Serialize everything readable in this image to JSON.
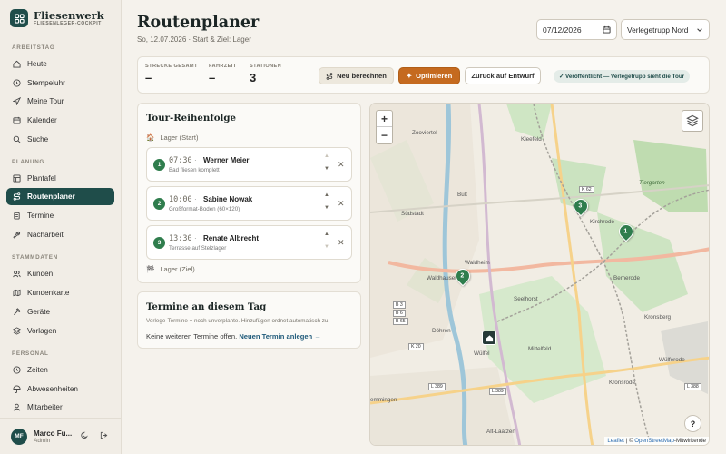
{
  "brand": {
    "name": "Fliesenwerk",
    "subtitle": "FLIESENLEGER-COCKPIT"
  },
  "nav": {
    "sections": {
      "arbeitstag": "ARBEITSTAG",
      "planung": "PLANUNG",
      "stammdaten": "STAMMDATEN",
      "persoenlich": "PERSONAL"
    },
    "items": {
      "heute": "Heute",
      "stempeluhr": "Stempeluhr",
      "meine_tour": "Meine Tour",
      "kalender": "Kalender",
      "suche": "Suche",
      "plantafel": "Plantafel",
      "routenplaner": "Routenplaner",
      "termine": "Termine",
      "nacharbeit": "Nacharbeit",
      "kunden": "Kunden",
      "kundenkarte": "Kundenkarte",
      "geraete": "Geräte",
      "vorlagen": "Vorlagen",
      "zeiten": "Zeiten",
      "abwesenheiten": "Abwesenheiten",
      "mitarbeiter": "Mitarbeiter"
    },
    "active": "routenplaner"
  },
  "user": {
    "initials": "MF",
    "name": "Marco Fu...",
    "role": "Admin"
  },
  "header": {
    "title": "Routenplaner",
    "subtitle": "So, 12.07.2026 · Start & Ziel: Lager",
    "date_value": "07/12/2026",
    "group_select": "Verlegetrupp Nord"
  },
  "stats": {
    "strecke_label": "STRECKE GESAMT",
    "strecke_value": "–",
    "fahrzeit_label": "FAHRZEIT",
    "fahrzeit_value": "–",
    "stationen_label": "STATIONEN",
    "stationen_value": "3"
  },
  "actions": {
    "recalc": "Neu berechnen",
    "optimize": "Optimieren",
    "draft": "Zurück auf Entwurf",
    "published": "✓ Veröffentlicht — Verlegetrupp sieht die Tour"
  },
  "tour": {
    "title": "Tour-Reihenfolge",
    "start": "Lager (Start)",
    "end": "Lager (Ziel)",
    "stops": [
      {
        "num": "1",
        "time": "07:30",
        "name": "Werner Meier",
        "desc": "Bad fliesen komplett"
      },
      {
        "num": "2",
        "time": "10:00",
        "name": "Sabine Nowak",
        "desc": "Großformat-Boden (60×120)"
      },
      {
        "num": "3",
        "time": "13:30",
        "name": "Renate Albrecht",
        "desc": "Terrasse auf Stelzlager"
      }
    ]
  },
  "termine": {
    "title": "Termine an diesem Tag",
    "sub": "Verlege-Termine + noch unverplante. Hinzufügen ordnet automatisch zu.",
    "text": "Keine weiteren Termine offen.",
    "link": "Neuen Termin anlegen →"
  },
  "map": {
    "zoom_in": "+",
    "zoom_out": "−",
    "attribution_leaflet": "Leaflet",
    "attribution_sep": " | © ",
    "attribution_osm": "OpenStreetMap",
    "attribution_rest": "-Mitwirkende",
    "help": "?",
    "labels": {
      "zooviertel": "Zooviertel",
      "kleefeld": "Kleefeld",
      "tiergarten": "Tiergarten",
      "bult": "Bult",
      "suedstadt": "Südstadt",
      "kirchrode": "Kirchrode",
      "waldhausen": "Waldhausen",
      "waldheim": "Waldheim",
      "bemerode": "Bemerode",
      "seelhorst": "Seelhorst",
      "doehren": "Döhren",
      "wuelfel": "Wülfel",
      "mittelfeld": "Mittelfeld",
      "kronsberg": "Kronsberg",
      "wuelferode": "Wülferode",
      "kronsrode": "Kronsrode",
      "emmingen": "emmingen",
      "altlaatzen": "Alt-Laatzen",
      "k62": "K 62",
      "b3": "B 3",
      "b6": "B 6",
      "b65": "B 65",
      "k20": "K 20",
      "l389": "L 389",
      "l388": "L 388",
      "l389b": "L 389"
    },
    "pins": [
      {
        "label": "1"
      },
      {
        "label": "2"
      },
      {
        "label": "3"
      }
    ]
  }
}
